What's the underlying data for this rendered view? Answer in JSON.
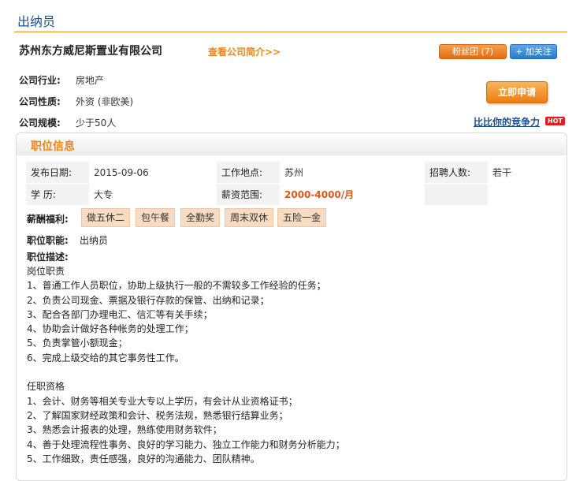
{
  "page": {
    "title": "出纳员"
  },
  "company": {
    "name": "苏州东方威尼斯置业有限公司",
    "intro_link": "查看公司简介>>",
    "fans_label": "粉丝团 (7)",
    "follow_label": "+ 加关注",
    "industry_label": "公司行业:",
    "industry": "房地产",
    "nature_label": "公司性质:",
    "nature": "外资 (非欧美)",
    "scale_label": "公司规模:",
    "scale": "少于50人",
    "apply_label": "立即申请",
    "compete_label": "比比你的竞争力",
    "hot_badge": "HOT"
  },
  "job": {
    "section_title": "职位信息",
    "publish_label": "发布日期:",
    "publish_date": "2015-09-06",
    "location_label": "工作地点:",
    "location": "苏州",
    "headcount_label": "招聘人数:",
    "headcount": "若干",
    "education_label": "学 历:",
    "education": "大专",
    "salary_label": "薪资范围:",
    "salary": "2000-4000/月",
    "welfare_label": "薪酬福利:",
    "welfare": [
      "做五休二",
      "包午餐",
      "全勤奖",
      "周末双休",
      "五险一金"
    ],
    "function_label": "职位职能:",
    "function": "出纳员",
    "desc_label": "职位描述:",
    "description": "岗位职责\n1、普通工作人员职位，协助上级执行一般的不需较多工作经验的任务；\n2、负责公司现金、票据及银行存款的保管、出纳和记录；\n3、配合各部门办理电汇、信汇等有关手续；\n4、协助会计做好各种帐务的处理工作；\n5、负责掌管小额现金；\n6、完成上级交给的其它事务性工作。\n\n任职资格\n1、会计、财务等相关专业大专以上学历，有会计从业资格证书；\n2、了解国家财经政策和会计、税务法规，熟悉银行结算业务；\n3、熟悉会计报表的处理，熟练使用财务软件；\n4、善于处理流程性事务、良好的学习能力、独立工作能力和财务分析能力；\n5、工作细致，责任感强，良好的沟通能力、团队精神。"
  }
}
